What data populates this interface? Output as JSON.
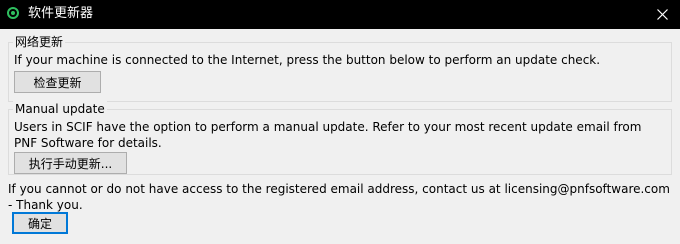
{
  "window": {
    "title": "软件更新器"
  },
  "online": {
    "group_title": "网络更新",
    "description": "If your machine is connected to the Internet, press the button below to perform an update check.",
    "button_label": "检查更新"
  },
  "manual": {
    "group_title": "Manual update",
    "description": "Users in SCIF have the option to perform a manual update. Refer to your most recent update email from PNF Software for details.",
    "button_label": "执行手动更新..."
  },
  "contact_text": "If you cannot or do not have access to the registered email address, contact us at licensing@pnfsoftware.com - Thank you.",
  "ok_label": "确定",
  "colors": {
    "accent": "#0078d7",
    "titlebar": "#000000",
    "icon": "#2fbf5f"
  },
  "icons": {
    "app": "updater-app-icon",
    "close": "close-icon"
  }
}
